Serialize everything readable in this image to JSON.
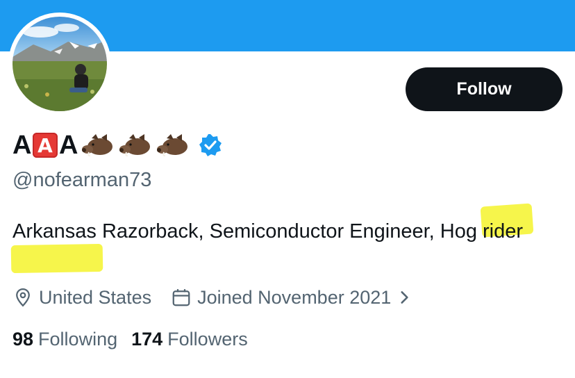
{
  "header": {
    "banner_color": "#1d9bf0",
    "follow_label": "Follow"
  },
  "profile": {
    "name_prefix": "A",
    "name_badge": "A",
    "name_suffix": "A",
    "name_emojis": [
      "boar-emoji",
      "boar-emoji",
      "boar-emoji"
    ],
    "verified": true,
    "handle": "@nofearman73",
    "bio": "Arkansas Razorback, Semiconductor Engineer, Hog rider",
    "highlighted_words": [
      "Hog",
      "rider"
    ],
    "highlight_color": "#f6f441",
    "location": "United States",
    "joined": "Joined November 2021"
  },
  "stats": {
    "following_count": "98",
    "following_label": "Following",
    "followers_count": "174",
    "followers_label": "Followers"
  }
}
